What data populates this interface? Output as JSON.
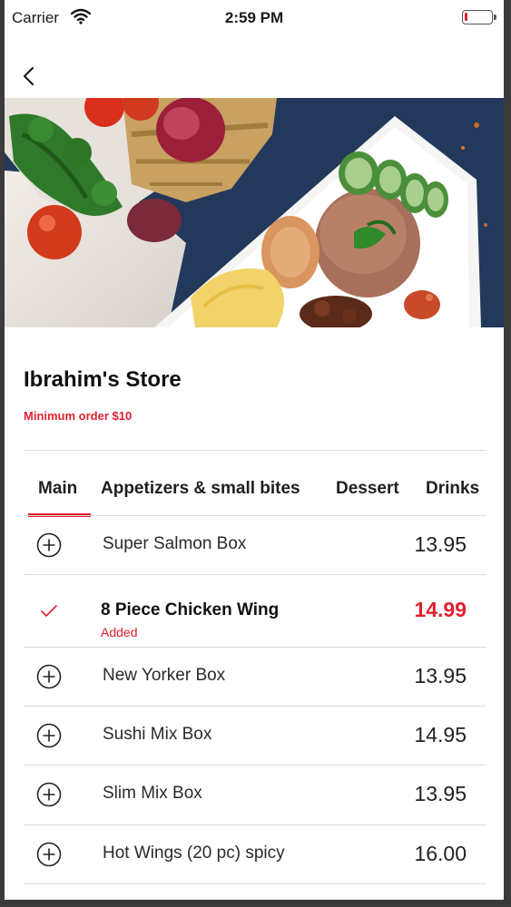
{
  "status_bar": {
    "carrier": "Carrier",
    "time": "2:59 PM",
    "battery_level": 0.1
  },
  "nav": {
    "back_icon": "chevron-left-icon"
  },
  "store": {
    "name": "Ibrahim's Store",
    "minimum_order": "Minimum order $10"
  },
  "tabs": [
    {
      "label": "Main",
      "active": true
    },
    {
      "label": "Appetizers & small bites",
      "active": false
    },
    {
      "label": "Dessert",
      "active": false
    },
    {
      "label": "Drinks",
      "active": false
    }
  ],
  "menu": {
    "items": [
      {
        "name": "Super Salmon Box",
        "price": "13.95",
        "added": false
      },
      {
        "name": "8 Piece Chicken Wing",
        "price": "14.99",
        "added": true,
        "added_label": "Added"
      },
      {
        "name": "New Yorker Box",
        "price": "13.95",
        "added": false
      },
      {
        "name": "Sushi Mix Box",
        "price": "14.95",
        "added": false
      },
      {
        "name": "Slim Mix Box",
        "price": "13.95",
        "added": false
      },
      {
        "name": "Hot Wings (20 pc) spicy",
        "price": "16.00",
        "added": false
      }
    ]
  },
  "colors": {
    "accent": "#e0202e",
    "divider": "#dcdcdc"
  }
}
